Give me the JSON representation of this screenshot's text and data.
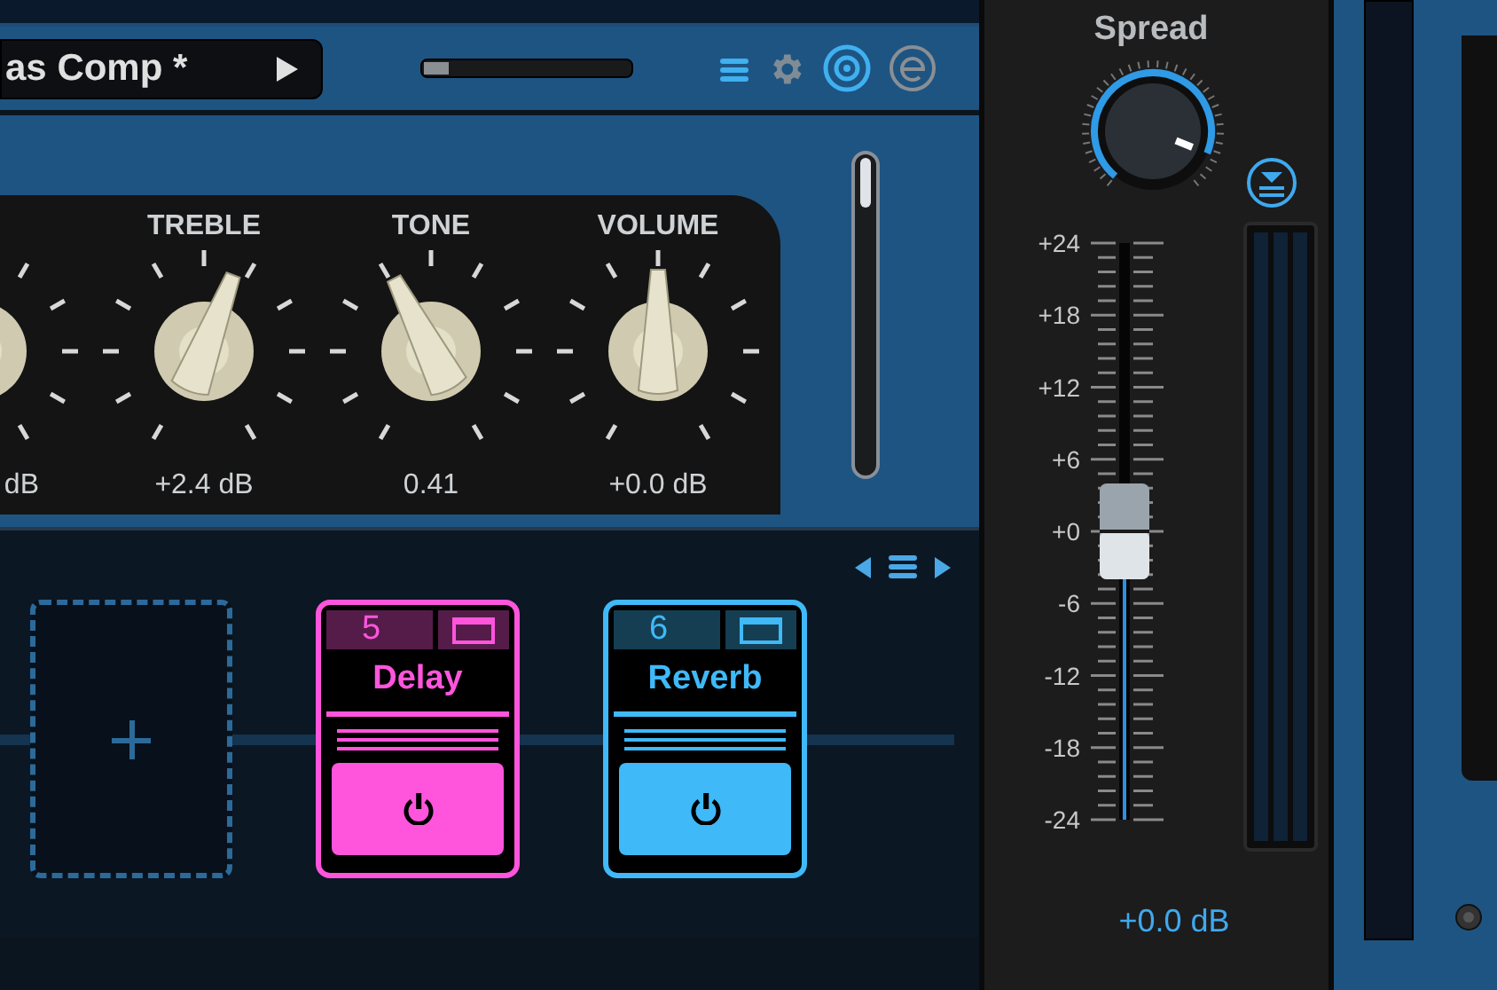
{
  "preset_bar": {
    "preset_name": "as Comp *",
    "input_meter": {
      "level": 0.12
    }
  },
  "amp": {
    "knobs": [
      {
        "value": "dB"
      },
      {
        "label": "TREBLE",
        "value": "+2.4 dB",
        "level": 0.57
      },
      {
        "label": "TONE",
        "value": "0.41",
        "level": 0.41
      },
      {
        "label": "VOLUME",
        "value": "+0.0 dB",
        "level": 0.5
      }
    ]
  },
  "pedalboard": {
    "slots": [
      {
        "kind": "empty"
      },
      {
        "kind": "effect",
        "number": "5",
        "name": "Delay",
        "color": "#ff55dd",
        "on": true
      },
      {
        "kind": "effect",
        "number": "6",
        "name": "Reverb",
        "color": "#3fb9f8",
        "on": true
      }
    ]
  },
  "output": {
    "title": "Spread",
    "spread": {
      "level": 0.9
    },
    "scale": [
      "+24",
      "+18",
      "+12",
      "+6",
      "+0",
      "-6",
      "-12",
      "-18",
      "-24"
    ],
    "fader": {
      "level": 0.5
    },
    "value": "+0.0 dB"
  }
}
